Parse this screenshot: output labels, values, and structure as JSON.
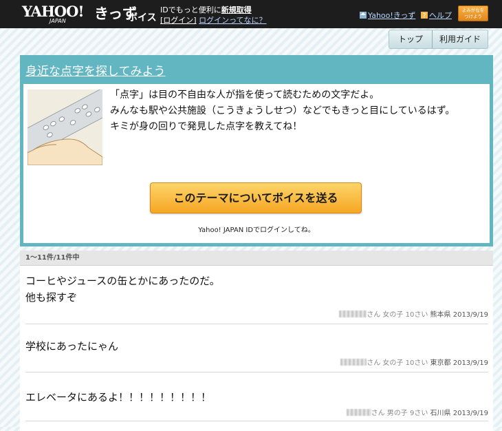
{
  "header": {
    "logo_text": "YAHOO!",
    "logo_sub": "JAPAN",
    "logo_kids": "きっず",
    "logo_voice": "ボイス",
    "tagline": "IDでもっと便利に",
    "register_link": "新規取得",
    "login_link": "[ログイン]",
    "login_help_link": "ログインってなに？",
    "kids_link": "Yahoo!きっず",
    "help_link": "ヘルプ",
    "yomigana_button": "よみがなを\nつけよう"
  },
  "nav": {
    "tabs": [
      {
        "label": "トップ"
      },
      {
        "label": "利用ガイド"
      }
    ]
  },
  "theme": {
    "title": "身近な点字を探してみよう",
    "description": [
      "「点字」は目の不自由な人が指を使って読むための文字だよ。",
      "みんなも駅や公共施設（こうきょうしせつ）などでもきっと目にしているはず。",
      "キミが身の回りで発見した点字を教えてね！"
    ],
    "send_button": "このテーマについてボイスを送る",
    "login_note": "Yahoo! JAPAN IDでログインしてね。"
  },
  "results": {
    "count": "1〜11件/11件中",
    "items": [
      {
        "text_lines": [
          "コーヒやジュースの缶とかにあったのだ。",
          "他も探すぞ"
        ],
        "suffix": "さん",
        "gender": "女の子",
        "age": "10さい",
        "prefecture": "熊本県",
        "date": "2013/9/19"
      },
      {
        "text_lines": [
          "学校にあったにゃん"
        ],
        "suffix": "さん",
        "gender": "女の子",
        "age": "10さい",
        "prefecture": "東京都",
        "date": "2013/9/19"
      },
      {
        "text_lines": [
          "エレベータにあるよ！！！！！！！！！"
        ],
        "suffix": "さん",
        "gender": "男の子",
        "age": "9さい",
        "prefecture": "石川県",
        "date": "2013/9/19"
      }
    ]
  },
  "colors": {
    "topbar": "#1d1d1d",
    "theme_frame": "#62b6c2",
    "button_orange": "#f6a623"
  }
}
